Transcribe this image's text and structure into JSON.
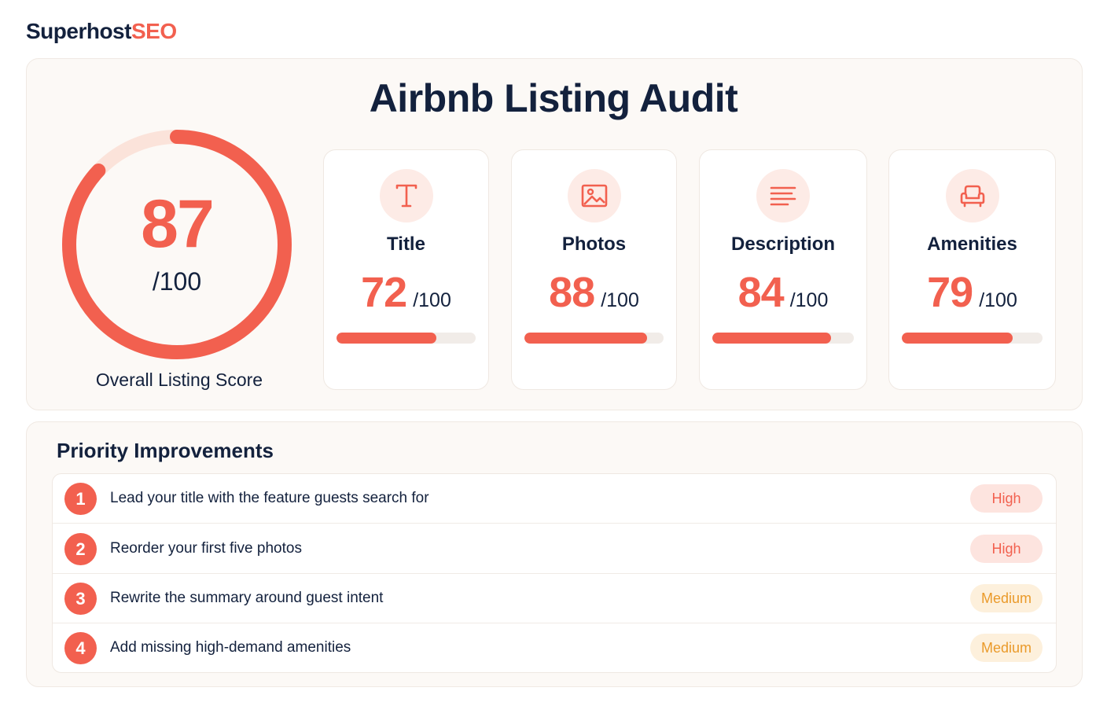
{
  "brand": {
    "part1": "Superhost",
    "part2": "SEO"
  },
  "title": "Airbnb Listing Audit",
  "overall": {
    "score": "87",
    "max": "/100",
    "value": 87,
    "label": "Overall Listing Score"
  },
  "cards": [
    {
      "label": "Title",
      "score": "72",
      "max": "/100",
      "value": 72,
      "icon": "title-icon"
    },
    {
      "label": "Photos",
      "score": "88",
      "max": "/100",
      "value": 88,
      "icon": "image-icon"
    },
    {
      "label": "Description",
      "score": "84",
      "max": "/100",
      "value": 84,
      "icon": "text-lines-icon"
    },
    {
      "label": "Amenities",
      "score": "79",
      "max": "/100",
      "value": 79,
      "icon": "armchair-icon"
    }
  ],
  "priority": {
    "title": "Priority Improvements",
    "items": [
      {
        "num": "1",
        "text": "Lead your title with the feature guests search for",
        "badge": "High"
      },
      {
        "num": "2",
        "text": "Reorder your first five photos",
        "badge": "High"
      },
      {
        "num": "3",
        "text": "Rewrite the summary around guest intent",
        "badge": "Medium"
      },
      {
        "num": "4",
        "text": "Add missing high-demand amenities",
        "badge": "Medium"
      }
    ]
  },
  "colors": {
    "accent": "#f2604f",
    "navy": "#13213d",
    "high_bg": "#fde4df",
    "medium_bg": "#fdf0dc",
    "medium_text": "#ea9a2a"
  }
}
